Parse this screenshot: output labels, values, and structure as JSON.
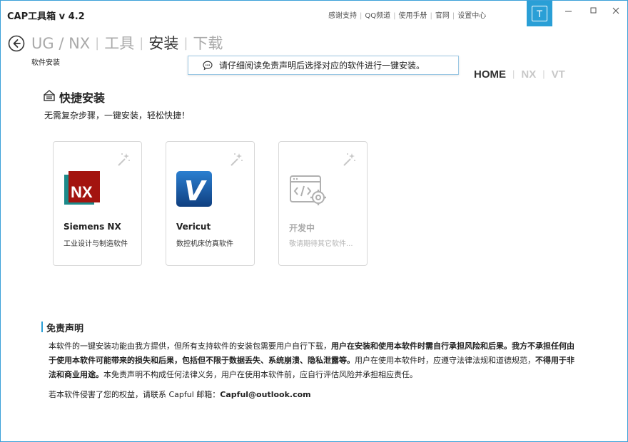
{
  "app": {
    "title": "CAP工具箱 v 4.2"
  },
  "toplinks": [
    "感谢支持",
    "QQ频道",
    "使用手册",
    "官网",
    "设置中心"
  ],
  "user_badge": "T",
  "breadcrumb": {
    "items": [
      "UG / NX",
      "工具",
      "安装",
      "下载"
    ],
    "active_index": 2,
    "subtitle": "软件安装"
  },
  "notice": {
    "text": "请仔细阅读免责声明后选择对应的软件进行一键安装。"
  },
  "right_nav": {
    "items": [
      "HOME",
      "NX",
      "VT"
    ],
    "active_index": 0
  },
  "quick_install": {
    "title": "快捷安装",
    "subtitle": "无需复杂步骤，一键安装，轻松快捷！"
  },
  "cards": [
    {
      "name": "Siemens NX",
      "desc": "工业设计与制造软件",
      "logo": "nx-logo",
      "logo_text": "NX",
      "enabled": true
    },
    {
      "name": "Vericut",
      "desc": "数控机床仿真软件",
      "logo": "vericut-logo",
      "logo_text": "V",
      "enabled": true
    },
    {
      "name": "开发中",
      "desc": "敬请期待其它软件...",
      "logo": "code-gear-icon",
      "enabled": false
    }
  ],
  "disclaimer": {
    "title": "免责声明",
    "p1_a": "本软件的一键安装功能由我方提供，但所有支持软件的安装包需要用户自行下载，",
    "p1_b": "用户在安装和使用本软件时需自行承担风险和后果。我方不承担任何由于使用本软件可能带来的损失和后果，包括但不限于数据丢失、系统崩溃、隐私泄露等。",
    "p1_c": "用户在使用本软件时，应遵守法律法规和道德规范，",
    "p1_d": "不得用于非法和商业用途。",
    "p1_e": "本免责声明不构成任何法律义务，用户在使用本软件前，应自行评估风险并承担相应责任。",
    "contact_prefix": "若本软件侵害了您的权益，请联系 Capful 邮箱：",
    "contact_email": "Capful@outlook.com"
  },
  "colors": {
    "accent": "#2a9fd6",
    "nx_red": "#a3140f",
    "nx_teal": "#1c8a8a",
    "vericut_blue": "#1a5fa8"
  }
}
